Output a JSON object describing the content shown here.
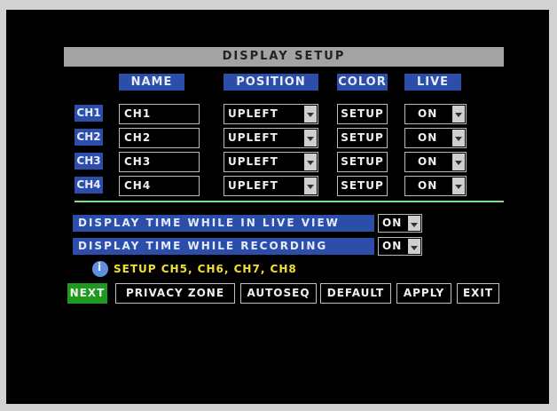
{
  "title": "DISPLAY SETUP",
  "headers": {
    "name": "NAME",
    "position": "POSITION",
    "color": "COLOR",
    "live": "LIVE"
  },
  "channels": [
    {
      "label": "CH1",
      "name": "CH1",
      "position": "UPLEFT",
      "color": "SETUP",
      "live": "ON"
    },
    {
      "label": "CH2",
      "name": "CH2",
      "position": "UPLEFT",
      "color": "SETUP",
      "live": "ON"
    },
    {
      "label": "CH3",
      "name": "CH3",
      "position": "UPLEFT",
      "color": "SETUP",
      "live": "ON"
    },
    {
      "label": "CH4",
      "name": "CH4",
      "position": "UPLEFT",
      "color": "SETUP",
      "live": "ON"
    }
  ],
  "options": {
    "live_view_label": "DISPLAY TIME WHILE IN LIVE VIEW",
    "live_view_value": "ON",
    "recording_label": "DISPLAY TIME WHILE RECORDING",
    "recording_value": "ON"
  },
  "hint": "SETUP CH5, CH6, CH7, CH8",
  "buttons": {
    "next": "NEXT",
    "privacy": "PRIVACY ZONE",
    "autoseq": "AUTOSEQ",
    "default": "DEFAULT",
    "apply": "APPLY",
    "exit": "EXIT"
  },
  "colors": {
    "accent_blue": "#2c4da8",
    "title_gray": "#a3a3a3",
    "next_green": "#1f9a1f",
    "hint_yellow": "#f0e030"
  },
  "icons": {
    "dropdown": "chevron-down-icon",
    "hint": "info-icon"
  }
}
